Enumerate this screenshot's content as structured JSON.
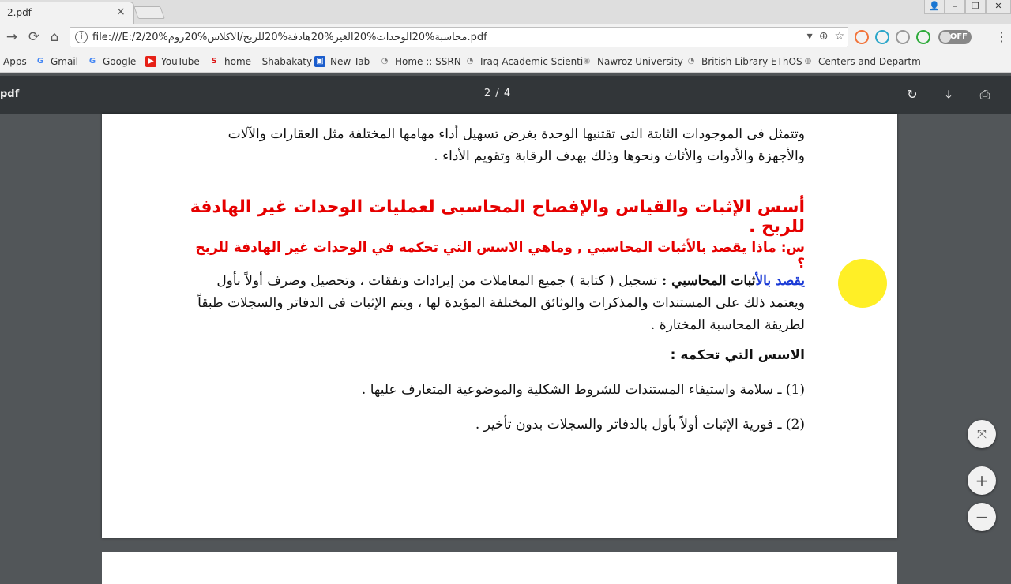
{
  "tab": {
    "title": "2.pdf",
    "close": "×"
  },
  "window": {
    "user": "👤",
    "minimize": "–",
    "maximize": "❐",
    "close": "✕"
  },
  "nav": {
    "back": "→",
    "reload": "⟳",
    "home": "⌂"
  },
  "omnibox": {
    "info": "i",
    "url": "file:///E:/2/محاسبة%20الوحدات%20الغير%20هادفة%20للربح/الاكلاس%20روم%20.pdf",
    "dropdown": "▾",
    "zoom": "⊕",
    "star": "☆"
  },
  "extensions": {
    "off_label": "OFF",
    "menu": "⋮"
  },
  "bookmarks": [
    {
      "label": "Apps",
      "icon": "apps-icon"
    },
    {
      "label": "Gmail",
      "icon": "google-icon"
    },
    {
      "label": "Google",
      "icon": "google-icon"
    },
    {
      "label": "YouTube",
      "icon": "youtube-icon"
    },
    {
      "label": "home – Shabakaty",
      "icon": "shabakaty-icon"
    },
    {
      "label": "New Tab",
      "icon": "newtab-icon"
    },
    {
      "label": "Home :: SSRN",
      "icon": "ssrn-icon"
    },
    {
      "label": "Iraq Academic Scienti",
      "icon": "iraq-academic-icon"
    },
    {
      "label": "Nawroz University",
      "icon": "nawroz-icon"
    },
    {
      "label": "British Library EThOS",
      "icon": "ethos-icon"
    },
    {
      "label": "Centers and Departm",
      "icon": "centers-icon"
    }
  ],
  "pdf": {
    "title": "pdf",
    "page_indicator": "2 / 4",
    "rotate": "↻",
    "download": "⤓",
    "print": "⎙"
  },
  "document": {
    "para1": "وتتمثل فى الموجودات الثابتة التى تقتنيها الوحدة بغرض تسهيل أداء مهامها المختلفة مثل العقارات والآلات والأجهزة والأدوات والأثاث ونحوها  وذلك بهدف الرقابة وتقويم الأداء  .",
    "heading": "أسس الإثبات والقياس والإفصاح المحاسبى لعمليات الوحدات غير الهادفة للربح .",
    "question": "س: ماذا يقصد بالأثبات المحاسبي , وماهي الاسس التي تحكمه في الوحدات غير الهادفة للربح ؟",
    "def_term_highlight": "يقصد بالأ",
    "def_term_rest": "ثبات المحاسبي : ",
    "def_body": "تسجيل ( كتابة ) جميع المعاملات من إيرادات ونفقات ، وتحصيل وصرف أولاً بأول ويعتمد ذلك على المستندات والمذكرات والوثائق المختلفة المؤيدة لها ، ويتم الإثبات فى الدفاتر والسجلات طبقاً لطريقة المحاسبة المختارة .",
    "subheading": "الاسس التي تحكمه :",
    "item1": "(1) ـ سلامة واستيفاء المستندات للشروط الشكلية والموضوعية المتعارف عليها .",
    "item2": "(2) ـ فورية الإثبات أولاً بأول بالدفاتر والسجلات بدون تأخير ."
  },
  "zoom": {
    "fit": "⤧",
    "in": "+",
    "out": "−"
  }
}
